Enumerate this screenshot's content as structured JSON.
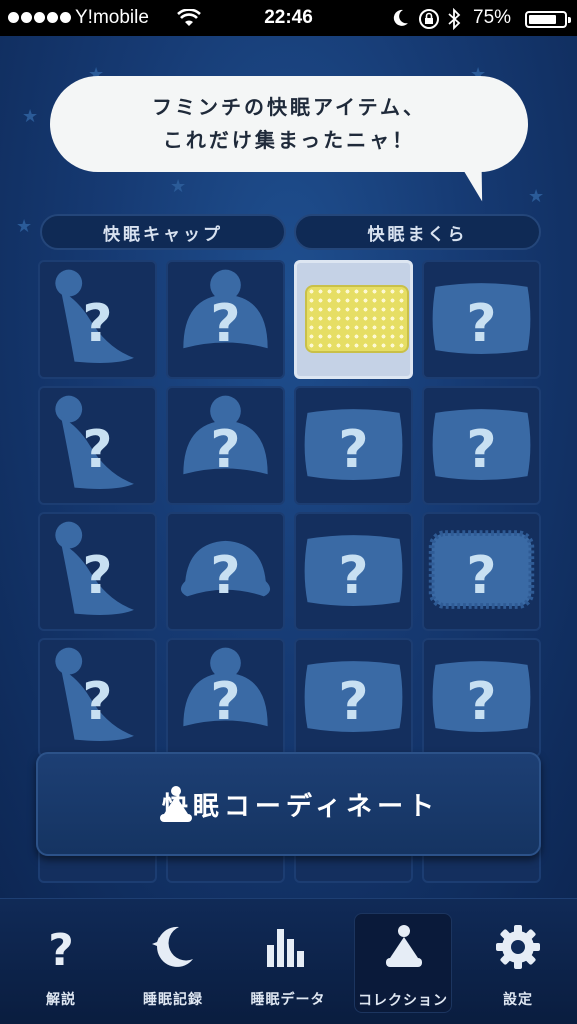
{
  "status_bar": {
    "carrier": "Y!mobile",
    "time": "22:46",
    "battery": "75%",
    "battery_level": 0.75
  },
  "speech_bubble": {
    "line1": "フミンチの快眠アイテム、",
    "line2": "これだけ集まったニャ！"
  },
  "categories": [
    {
      "label": "快眠キャップ"
    },
    {
      "label": "快眠まくら"
    }
  ],
  "grid": {
    "unknown_mark": "?",
    "rows": [
      [
        "cap-nightcap",
        "cap-beanie",
        "pillow-yellow-dots",
        "pillow"
      ],
      [
        "cap-nightcap",
        "cap-beanie",
        "pillow",
        "pillow"
      ],
      [
        "cap-nightcap",
        "cap-bonnet",
        "pillow",
        "pillow-fluffy"
      ],
      [
        "cap-nightcap",
        "cap-beanie",
        "pillow",
        "pillow"
      ]
    ],
    "owned": [
      "pillow-yellow-dots"
    ]
  },
  "coord_button": {
    "label": "快眠コーディネート",
    "icon": "nightcap-icon"
  },
  "tabs": [
    {
      "label": "解説",
      "icon": "question-icon",
      "active": false
    },
    {
      "label": "睡眠記録",
      "icon": "moon-star-icon",
      "active": false
    },
    {
      "label": "睡眠データ",
      "icon": "bar-chart-icon",
      "active": false
    },
    {
      "label": "コレクション",
      "icon": "nightcap-icon",
      "active": true
    },
    {
      "label": "設定",
      "icon": "gear-icon",
      "active": false
    }
  ],
  "colors": {
    "background": "#163a73",
    "cell": "#142f5e",
    "owned_cell": "#c5d2e6",
    "question_mark": "#c8e0f2"
  }
}
